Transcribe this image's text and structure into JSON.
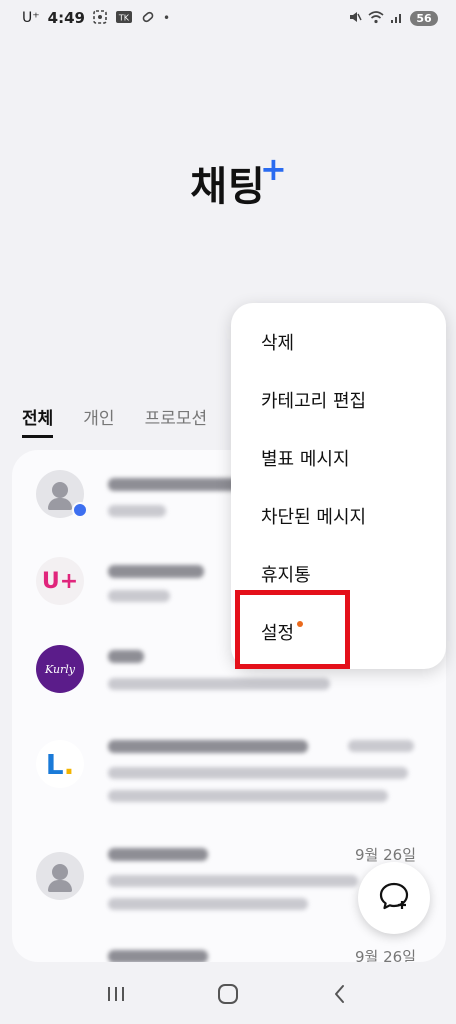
{
  "status_bar": {
    "carrier": "U⁺",
    "time": "4:49",
    "left_icons": [
      "screenshot-icon",
      "kakaotalk-icon",
      "pill-icon"
    ],
    "dot": "•",
    "right_icons": [
      "mute-icon",
      "wifi-icon",
      "signal-icon"
    ],
    "battery": "56"
  },
  "header": {
    "title": "채팅",
    "title_plus": "+"
  },
  "tabs": [
    {
      "label": "전체",
      "active": true
    },
    {
      "label": "개인",
      "active": false
    },
    {
      "label": "프로모션",
      "active": false
    }
  ],
  "chat_list": [
    {
      "avatar": "default-person-icon",
      "date": "",
      "has_unread_dot": true
    },
    {
      "avatar": "uplus-logo",
      "avatar_text": "U+",
      "date": ""
    },
    {
      "avatar": "kurly-logo",
      "avatar_text": "Kurly",
      "date": ""
    },
    {
      "avatar": "lpoint-logo",
      "avatar_text": "L",
      "avatar_dot": ".",
      "date": ""
    },
    {
      "avatar": "default-person-icon",
      "date": "9월 26일"
    },
    {
      "avatar": "default-person-icon",
      "date": "9월 26일"
    }
  ],
  "menu": {
    "items": [
      {
        "label": "삭제"
      },
      {
        "label": "카테고리 편집"
      },
      {
        "label": "별표 메시지"
      },
      {
        "label": "차단된 메시지"
      },
      {
        "label": "휴지통"
      },
      {
        "label": "설정",
        "has_dot": true
      }
    ]
  },
  "colors": {
    "accent_blue": "#2a6bf0",
    "highlight_red": "#e4101a",
    "notification_orange": "#ea6a1d",
    "uplus_pink": "#e0257c",
    "kurly_purple": "#5b1c8a"
  },
  "fab": {
    "icon": "new-chat-icon"
  },
  "nav": [
    "recent-apps-icon",
    "home-icon",
    "back-icon"
  ]
}
